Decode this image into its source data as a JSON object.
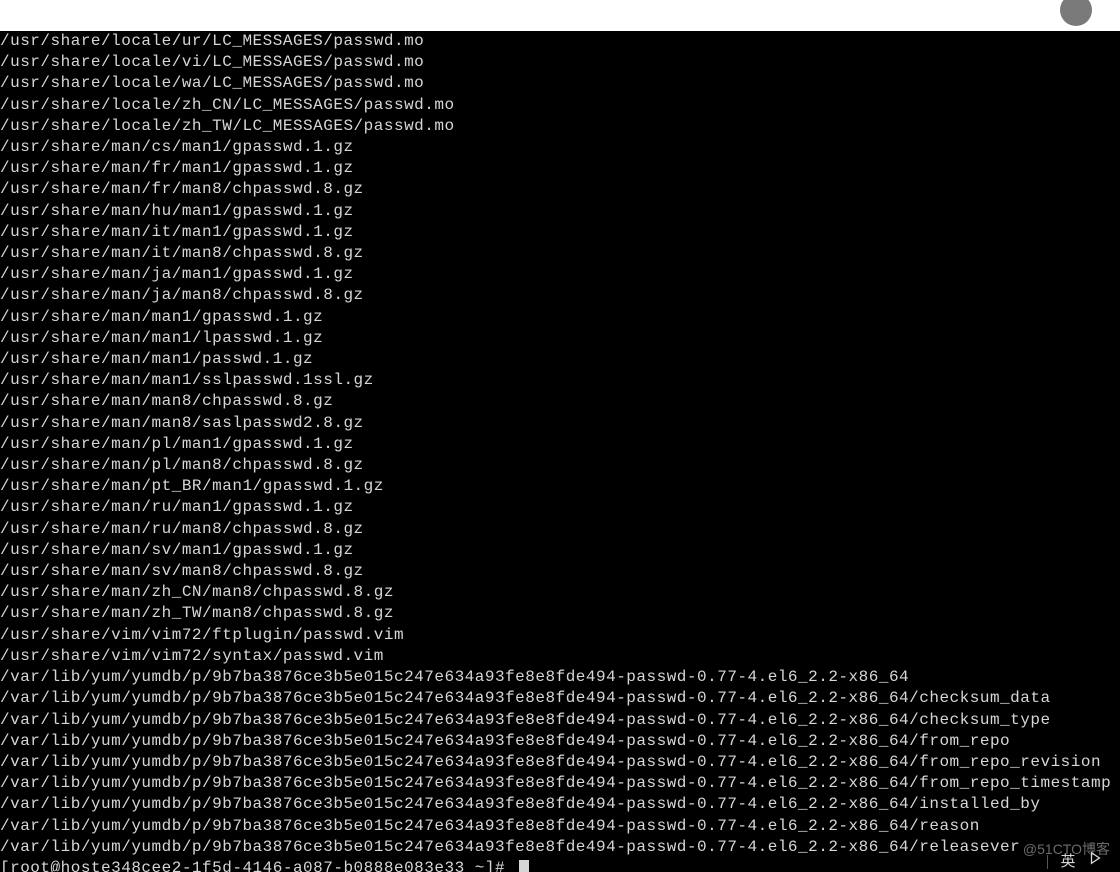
{
  "topbar": {},
  "terminal": {
    "lines": [
      "/usr/share/locale/ur/LC_MESSAGES/passwd.mo",
      "/usr/share/locale/vi/LC_MESSAGES/passwd.mo",
      "/usr/share/locale/wa/LC_MESSAGES/passwd.mo",
      "/usr/share/locale/zh_CN/LC_MESSAGES/passwd.mo",
      "/usr/share/locale/zh_TW/LC_MESSAGES/passwd.mo",
      "/usr/share/man/cs/man1/gpasswd.1.gz",
      "/usr/share/man/fr/man1/gpasswd.1.gz",
      "/usr/share/man/fr/man8/chpasswd.8.gz",
      "/usr/share/man/hu/man1/gpasswd.1.gz",
      "/usr/share/man/it/man1/gpasswd.1.gz",
      "/usr/share/man/it/man8/chpasswd.8.gz",
      "/usr/share/man/ja/man1/gpasswd.1.gz",
      "/usr/share/man/ja/man8/chpasswd.8.gz",
      "/usr/share/man/man1/gpasswd.1.gz",
      "/usr/share/man/man1/lpasswd.1.gz",
      "/usr/share/man/man1/passwd.1.gz",
      "/usr/share/man/man1/sslpasswd.1ssl.gz",
      "/usr/share/man/man8/chpasswd.8.gz",
      "/usr/share/man/man8/saslpasswd2.8.gz",
      "/usr/share/man/pl/man1/gpasswd.1.gz",
      "/usr/share/man/pl/man8/chpasswd.8.gz",
      "/usr/share/man/pt_BR/man1/gpasswd.1.gz",
      "/usr/share/man/ru/man1/gpasswd.1.gz",
      "/usr/share/man/ru/man8/chpasswd.8.gz",
      "/usr/share/man/sv/man1/gpasswd.1.gz",
      "/usr/share/man/sv/man8/chpasswd.8.gz",
      "/usr/share/man/zh_CN/man8/chpasswd.8.gz",
      "/usr/share/man/zh_TW/man8/chpasswd.8.gz",
      "/usr/share/vim/vim72/ftplugin/passwd.vim",
      "/usr/share/vim/vim72/syntax/passwd.vim",
      "/var/lib/yum/yumdb/p/9b7ba3876ce3b5e015c247e634a93fe8e8fde494-passwd-0.77-4.el6_2.2-x86_64",
      "/var/lib/yum/yumdb/p/9b7ba3876ce3b5e015c247e634a93fe8e8fde494-passwd-0.77-4.el6_2.2-x86_64/checksum_data",
      "/var/lib/yum/yumdb/p/9b7ba3876ce3b5e015c247e634a93fe8e8fde494-passwd-0.77-4.el6_2.2-x86_64/checksum_type",
      "/var/lib/yum/yumdb/p/9b7ba3876ce3b5e015c247e634a93fe8e8fde494-passwd-0.77-4.el6_2.2-x86_64/from_repo",
      "/var/lib/yum/yumdb/p/9b7ba3876ce3b5e015c247e634a93fe8e8fde494-passwd-0.77-4.el6_2.2-x86_64/from_repo_revision",
      "/var/lib/yum/yumdb/p/9b7ba3876ce3b5e015c247e634a93fe8e8fde494-passwd-0.77-4.el6_2.2-x86_64/from_repo_timestamp",
      "/var/lib/yum/yumdb/p/9b7ba3876ce3b5e015c247e634a93fe8e8fde494-passwd-0.77-4.el6_2.2-x86_64/installed_by",
      "/var/lib/yum/yumdb/p/9b7ba3876ce3b5e015c247e634a93fe8e8fde494-passwd-0.77-4.el6_2.2-x86_64/reason",
      "/var/lib/yum/yumdb/p/9b7ba3876ce3b5e015c247e634a93fe8e8fde494-passwd-0.77-4.el6_2.2-x86_64/releasever"
    ],
    "prompt": "[root@hoste348cee2-1f5d-4146-a087-b0888e083e33 ~]# "
  },
  "watermark": "@51CTO博客",
  "ime": {
    "lang": "英"
  }
}
